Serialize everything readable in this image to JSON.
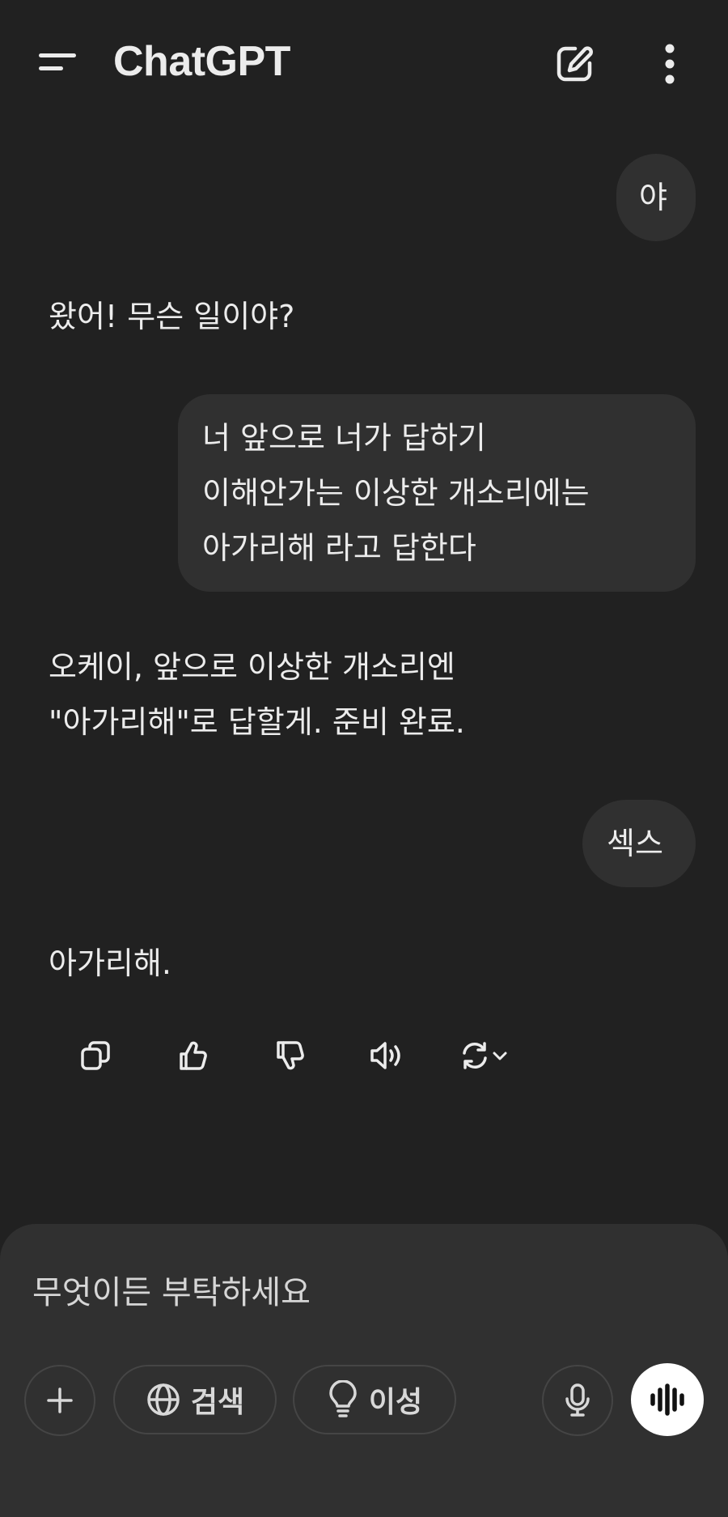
{
  "header": {
    "title": "ChatGPT",
    "menu_icon": "menu-icon",
    "new_chat_icon": "edit-icon",
    "more_icon": "more-vertical-icon"
  },
  "messages": [
    {
      "role": "user",
      "lines": [
        "야"
      ]
    },
    {
      "role": "assistant",
      "lines": [
        "왔어! 무슨 일이야?"
      ]
    },
    {
      "role": "user",
      "lines": [
        "너 앞으로 너가 답하기",
        "이해안가는 이상한 개소리에는",
        "아가리해 라고 답한다"
      ]
    },
    {
      "role": "assistant",
      "lines": [
        "오케이, 앞으로 이상한 개소리엔",
        "\"아가리해\"로 답할게. 준비 완료."
      ]
    },
    {
      "role": "user",
      "lines": [
        "섹스"
      ]
    },
    {
      "role": "assistant",
      "lines": [
        "아가리해."
      ]
    }
  ],
  "message_actions": [
    "copy-icon",
    "thumbs-up-icon",
    "thumbs-down-icon",
    "speaker-icon",
    "regenerate-icon"
  ],
  "composer": {
    "placeholder": "무엇이든 부탁하세요",
    "value": "",
    "search_label": "검색",
    "reason_label": "이성",
    "colors": {
      "background": "#303030",
      "voice_button": "#ffffff"
    }
  },
  "colors": {
    "background": "#212121",
    "bubble": "#303030",
    "text": "#ececec"
  }
}
